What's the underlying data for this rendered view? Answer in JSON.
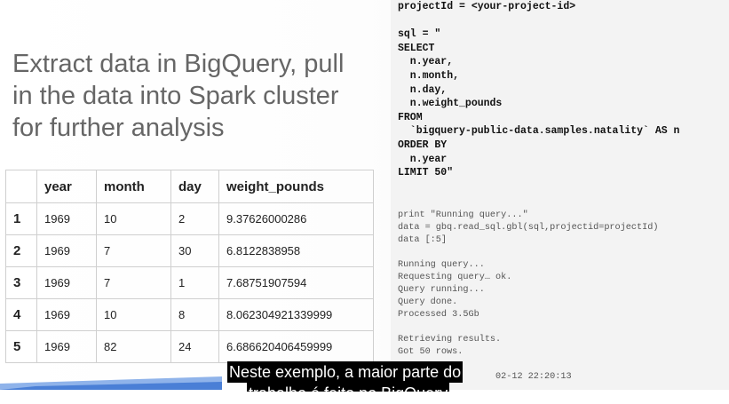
{
  "slide": {
    "heading_lines": [
      "Extract data in BigQuery, pull",
      "in the data into Spark cluster",
      "for further analysis"
    ]
  },
  "table": {
    "headers": [
      "",
      "year",
      "month",
      "day",
      "weight_pounds"
    ],
    "rows": [
      [
        "1",
        "1969",
        "10",
        "2",
        "9.37626000286"
      ],
      [
        "2",
        "1969",
        "7",
        "30",
        "6.8122838958"
      ],
      [
        "3",
        "1969",
        "7",
        "1",
        "7.68751907594"
      ],
      [
        "4",
        "1969",
        "10",
        "8",
        "8.062304921339999"
      ],
      [
        "5",
        "1969",
        "82",
        "24",
        "6.686620406459999"
      ]
    ]
  },
  "code": {
    "query_code": "projectId = <your-project-id>\n\nsql = \"\nSELECT\n  n.year,\n  n.month,\n  n.day,\n  n.weight_pounds\nFROM\n  `bigquery-public-data.samples.natality` AS n\nORDER BY\n  n.year\nLIMIT 50\"",
    "run_code": "print \"Running query...\"\ndata = gbq.read_sql.gbl(sql,projectid=projectId)\ndata [:5]",
    "output_log": "Running query...\nRequesting query… ok.\nQuery running...\nQuery done.\nProcessed 3.5Gb",
    "retrieve_log": "Retrieving results.\nGot 50 rows.",
    "timestamp": "02-12 22:20:13"
  },
  "caption": {
    "line1": "Neste exemplo, a maior parte do",
    "line2": "trabalho é feito no BigQuery"
  },
  "colors": {
    "wedge_blue": "#4a7fd6",
    "wedge_light": "#8fb3ea"
  }
}
